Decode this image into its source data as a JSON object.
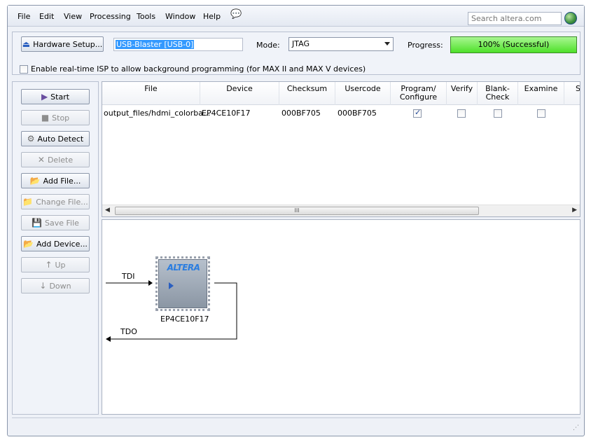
{
  "menu": {
    "items": [
      "File",
      "Edit",
      "View",
      "Processing",
      "Tools",
      "Window",
      "Help"
    ],
    "search_placeholder": "Search altera.com"
  },
  "toolbar": {
    "hardware_setup_label": "Hardware Setup...",
    "device_value": "USB-Blaster [USB-0]",
    "mode_label": "Mode:",
    "mode_value": "JTAG",
    "progress_label": "Progress:",
    "progress_text": "100% (Successful)",
    "progress_fraction": 1.0,
    "progress_color": "#4ee02a",
    "isp_label": "Enable real-time ISP to allow background programming (for MAX II and MAX V devices)",
    "isp_checked": false
  },
  "side_buttons": [
    {
      "label": "Start",
      "icon": "start-icon",
      "enabled": true
    },
    {
      "label": "Stop",
      "icon": "stop-icon",
      "enabled": false
    },
    {
      "label": "Auto Detect",
      "icon": "auto-detect-icon",
      "enabled": true
    },
    {
      "label": "Delete",
      "icon": "delete-icon",
      "enabled": false
    },
    {
      "label": "Add File...",
      "icon": "add-file-icon",
      "enabled": true
    },
    {
      "label": "Change File...",
      "icon": "change-file-icon",
      "enabled": false
    },
    {
      "label": "Save File",
      "icon": "save-file-icon",
      "enabled": false
    },
    {
      "label": "Add Device...",
      "icon": "add-device-icon",
      "enabled": true
    },
    {
      "label": "Up",
      "icon": "up-icon",
      "enabled": false
    },
    {
      "label": "Down",
      "icon": "down-icon",
      "enabled": false
    }
  ],
  "table": {
    "headers": [
      "File",
      "Device",
      "Checksum",
      "Usercode",
      "Program/\nConfigure",
      "Verify",
      "Blank-\nCheck",
      "Examine",
      "S"
    ],
    "rows": [
      {
        "file": "output_files/hdmi_colorba...",
        "device": "EP4CE10F17",
        "checksum": "000BF705",
        "usercode": "000BF705",
        "program": true,
        "verify": false,
        "blank_check": false,
        "examine": false
      }
    ],
    "scroll_thumb_label": "III"
  },
  "chain": {
    "tdi_label": "TDI",
    "tdo_label": "TDO",
    "chip_logo": "ALTERA",
    "chip_device": "EP4CE10F17"
  }
}
